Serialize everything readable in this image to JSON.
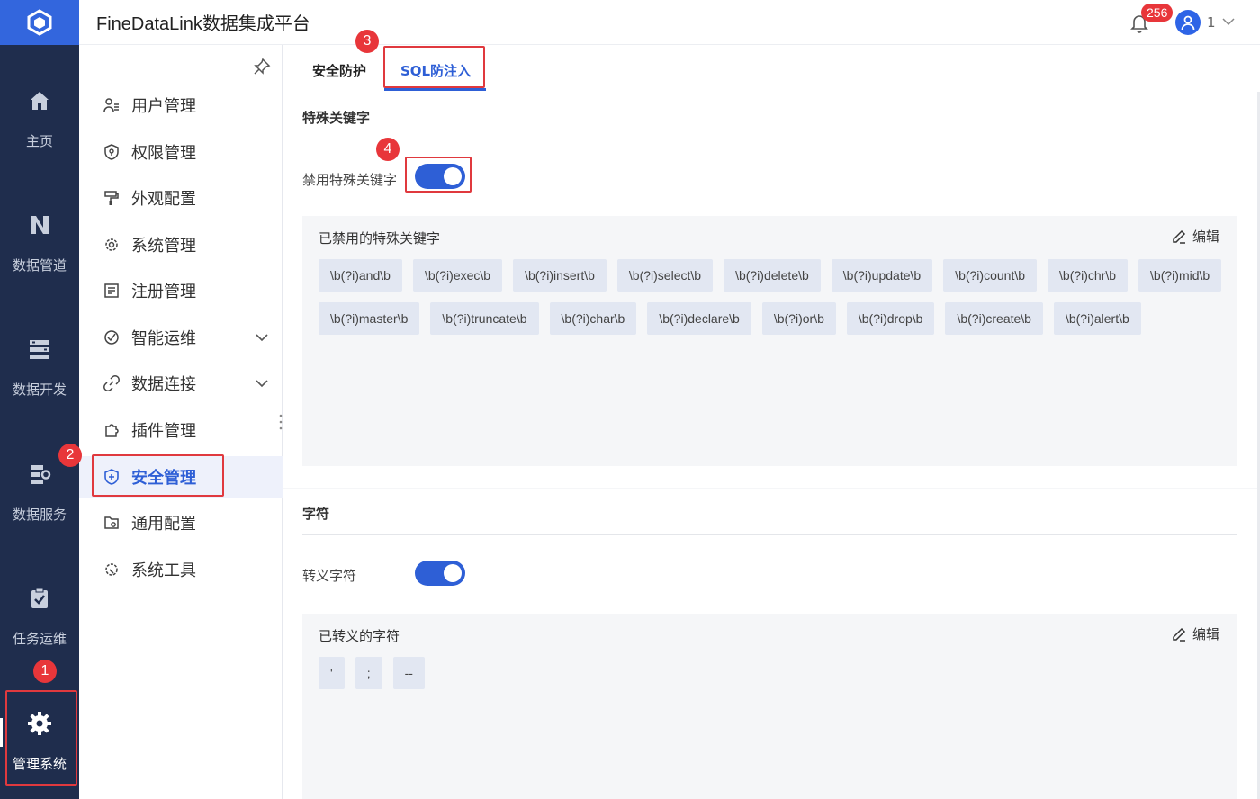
{
  "header": {
    "title": "FineDataLink数据集成平台",
    "notification_count": "256",
    "user_name": "1"
  },
  "rail": {
    "items": [
      {
        "label": "主页",
        "icon": "home-icon"
      },
      {
        "label": "数据管道",
        "icon": "pipeline-icon"
      },
      {
        "label": "数据开发",
        "icon": "data-dev-icon"
      },
      {
        "label": "数据服务",
        "icon": "data-service-icon"
      },
      {
        "label": "任务运维",
        "icon": "task-ops-icon"
      },
      {
        "label": "管理系统",
        "icon": "gear-icon"
      }
    ]
  },
  "submenu": {
    "items": [
      {
        "label": "用户管理",
        "icon": "user-list-icon"
      },
      {
        "label": "权限管理",
        "icon": "shield-key-icon"
      },
      {
        "label": "外观配置",
        "icon": "paint-roller-icon"
      },
      {
        "label": "系统管理",
        "icon": "gear-icon"
      },
      {
        "label": "注册管理",
        "icon": "register-icon"
      },
      {
        "label": "智能运维",
        "icon": "ops-icon"
      },
      {
        "label": "数据连接",
        "icon": "link-icon"
      },
      {
        "label": "插件管理",
        "icon": "puzzle-icon"
      },
      {
        "label": "安全管理",
        "icon": "shield-icon"
      },
      {
        "label": "通用配置",
        "icon": "folder-gear-icon"
      },
      {
        "label": "系统工具",
        "icon": "tool-icon"
      }
    ]
  },
  "tabs": [
    {
      "label": "安全防护"
    },
    {
      "label": "SQL防注入"
    }
  ],
  "keywords_section": {
    "title": "特殊关键字",
    "toggle_label": "禁用特殊关键字",
    "toggle_on": true,
    "box_title": "已禁用的特殊关键字",
    "edit_label": "编辑",
    "tags": [
      "\\b(?i)and\\b",
      "\\b(?i)exec\\b",
      "\\b(?i)insert\\b",
      "\\b(?i)select\\b",
      "\\b(?i)delete\\b",
      "\\b(?i)update\\b",
      "\\b(?i)count\\b",
      "\\b(?i)chr\\b",
      "\\b(?i)mid\\b",
      "\\b(?i)master\\b",
      "\\b(?i)truncate\\b",
      "\\b(?i)char\\b",
      "\\b(?i)declare\\b",
      "\\b(?i)or\\b",
      "\\b(?i)drop\\b",
      "\\b(?i)create\\b",
      "\\b(?i)alert\\b"
    ]
  },
  "chars_section": {
    "title": "字符",
    "toggle_label": "转义字符",
    "toggle_on": true,
    "box_title": "已转义的字符",
    "edit_label": "编辑",
    "tags": [
      "'",
      ";",
      "--"
    ]
  },
  "markers": [
    "1",
    "2",
    "3",
    "4"
  ],
  "colors": {
    "accent": "#2e5fd6",
    "rail_bg": "#1f2d4d",
    "highlight": "#e0393e"
  }
}
